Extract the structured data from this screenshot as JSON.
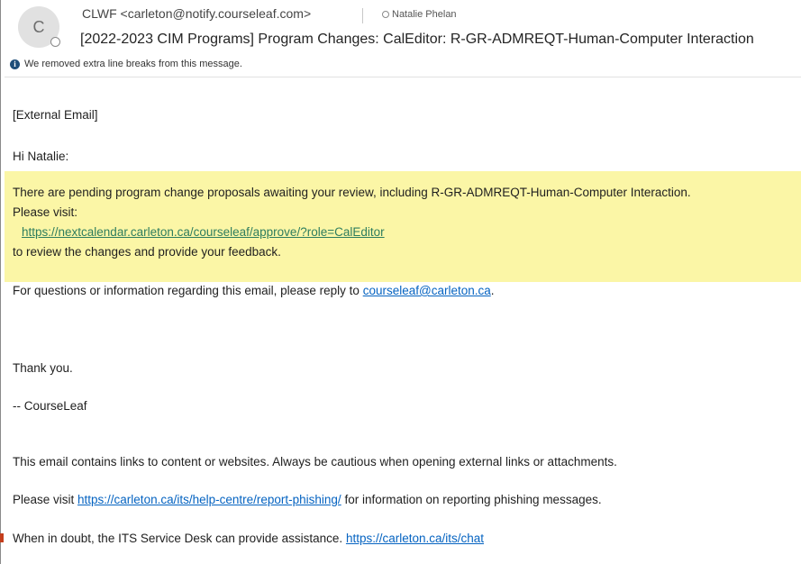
{
  "header": {
    "avatar_initial": "C",
    "from": "CLWF <carleton@notify.courseleaf.com>",
    "to": "Natalie Phelan",
    "subject": "[2022-2023 CIM Programs] Program Changes: CalEditor: R-GR-ADMREQT-Human-Computer Interaction",
    "info_notice": "We removed extra line breaks from this message."
  },
  "body": {
    "external_tag": "[External Email]",
    "greeting": "Hi Natalie:",
    "pending_line": "There are pending program change proposals awaiting your review, including R-GR-ADMREQT-Human-Computer Interaction.",
    "please_visit": "Please visit:",
    "approve_link": "https://nextcalendar.carleton.ca/courseleaf/approve/?role=CalEditor",
    "review_line": "to review the changes and provide your feedback.",
    "questions_prefix": "For questions or information regarding this email, please reply to ",
    "questions_email": "courseleaf@carleton.ca",
    "questions_suffix": ".",
    "thanks": "Thank you.",
    "signature": "-- CourseLeaf",
    "caution": "This email contains links to content or websites. Always be cautious when opening external links or attachments.",
    "phishing_prefix": "Please visit ",
    "phishing_link": "https://carleton.ca/its/help-centre/report-phishing/",
    "phishing_suffix": " for information on reporting phishing messages.",
    "doubt_prefix": "When in doubt, the ITS Service Desk can provide assistance. ",
    "chat_link": "https://carleton.ca/its/chat"
  },
  "colors": {
    "highlight": "#fbf6a6",
    "link": "#0563c1",
    "highlight_link": "#2e7d5e"
  }
}
